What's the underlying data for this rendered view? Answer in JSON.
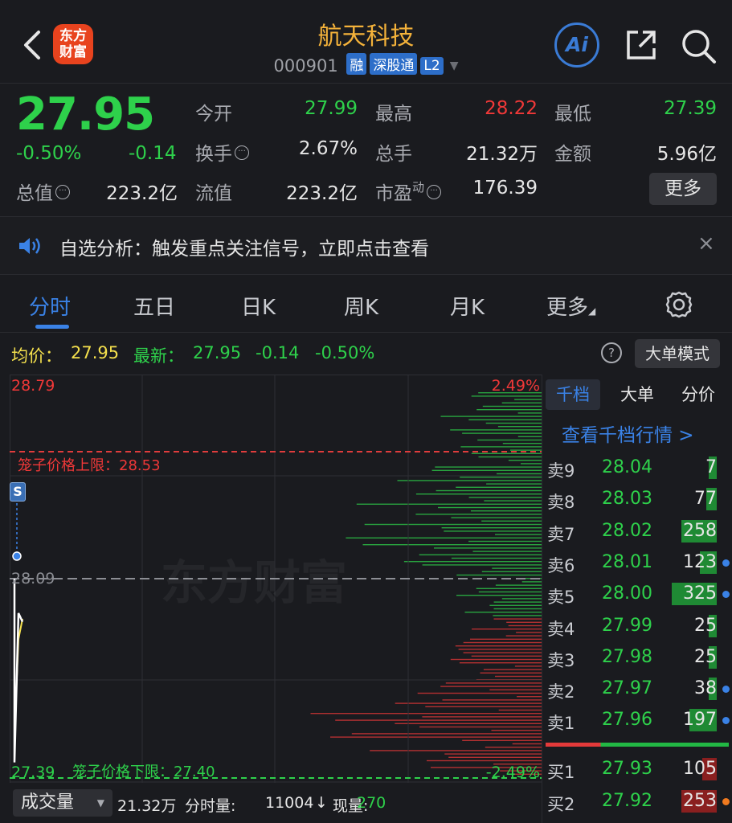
{
  "header": {
    "logo_line1": "东方",
    "logo_line2": "财富",
    "title": "航天科技",
    "code": "000901",
    "tags": [
      "融",
      "深股通",
      "L2"
    ],
    "ai_label": "Ai"
  },
  "quote": {
    "price": "27.95",
    "change_pct": "-0.50%",
    "change": "-0.14",
    "fields": {
      "open_label": "今开",
      "open": "27.99",
      "high_label": "最高",
      "high": "28.22",
      "low_label": "最低",
      "low": "27.39",
      "turnover_label": "换手",
      "turnover": "2.67%",
      "volume_label": "总手",
      "volume": "21.32万",
      "amount_label": "金额",
      "amount": "5.96亿",
      "mcap_label": "总值",
      "mcap": "223.2亿",
      "float_label": "流值",
      "float": "223.2亿",
      "pe_label": "市盈",
      "pe_sup": "动",
      "pe": "176.39"
    },
    "more_label": "更多"
  },
  "notice": {
    "text": "自选分析：触发重点关注信号，立即点击查看",
    "close": "×"
  },
  "tabs": {
    "items": [
      "分时",
      "五日",
      "日K",
      "周K",
      "月K",
      "更多"
    ],
    "active": "分时"
  },
  "stats": {
    "avg_label": "均价：",
    "avg": "27.95",
    "last_label": "最新：",
    "last": "27.95",
    "chg": "-0.14",
    "pct": "-0.50%",
    "help": "?",
    "mode_button": "大单模式"
  },
  "chart": {
    "top_price": "28.79",
    "top_pct": "2.49%",
    "upper_limit_label": "笼子价格上限：28.53",
    "mid_price": "28.09",
    "bottom_price": "27.39",
    "lower_limit_label": "笼子价格下限：27.40",
    "bottom_pct": "-2.49%",
    "marker": "S",
    "watermark": "东方财富",
    "colors": {
      "up": "#f03838",
      "down": "#2ed14b",
      "avg": "#f4e04d",
      "price_line": "#ffffff"
    }
  },
  "chart_data": {
    "type": "line",
    "title": "",
    "ylim": [
      27.39,
      28.79
    ],
    "prev_close": 28.09,
    "series": [
      {
        "name": "",
        "x": [
          0,
          1,
          2,
          3
        ],
        "values": [
          28.09,
          27.45,
          27.97,
          27.94
        ]
      },
      {
        "name": "",
        "x": [
          0,
          1,
          2,
          3
        ],
        "values": [
          28.09,
          27.55,
          27.88,
          27.95
        ]
      }
    ]
  },
  "volume": {
    "button": "成交量",
    "total": "21.32万",
    "period_label": "分时量:",
    "period": "11004",
    "arrow": "↓",
    "current_label": "现量:",
    "current": "270"
  },
  "orderbook": {
    "tabs": [
      "千档",
      "大单",
      "分价"
    ],
    "active_tab": "千档",
    "link": "查看千档行情 >",
    "asks": [
      {
        "label": "卖9",
        "price": "28.04",
        "qty": "7",
        "dot": ""
      },
      {
        "label": "卖8",
        "price": "28.03",
        "qty": "77",
        "dot": ""
      },
      {
        "label": "卖7",
        "price": "28.02",
        "qty": "258",
        "dot": ""
      },
      {
        "label": "卖6",
        "price": "28.01",
        "qty": "123",
        "dot": "blue"
      },
      {
        "label": "卖5",
        "price": "28.00",
        "qty": "325",
        "dot": "blue"
      },
      {
        "label": "卖4",
        "price": "27.99",
        "qty": "25",
        "dot": ""
      },
      {
        "label": "卖3",
        "price": "27.98",
        "qty": "25",
        "dot": ""
      },
      {
        "label": "卖2",
        "price": "27.97",
        "qty": "38",
        "dot": "blue"
      },
      {
        "label": "卖1",
        "price": "27.96",
        "qty": "197",
        "dot": "blue"
      }
    ],
    "bids": [
      {
        "label": "买1",
        "price": "27.93",
        "qty": "105",
        "dot": ""
      },
      {
        "label": "买2",
        "price": "27.92",
        "qty": "253",
        "dot": "orange"
      }
    ]
  }
}
